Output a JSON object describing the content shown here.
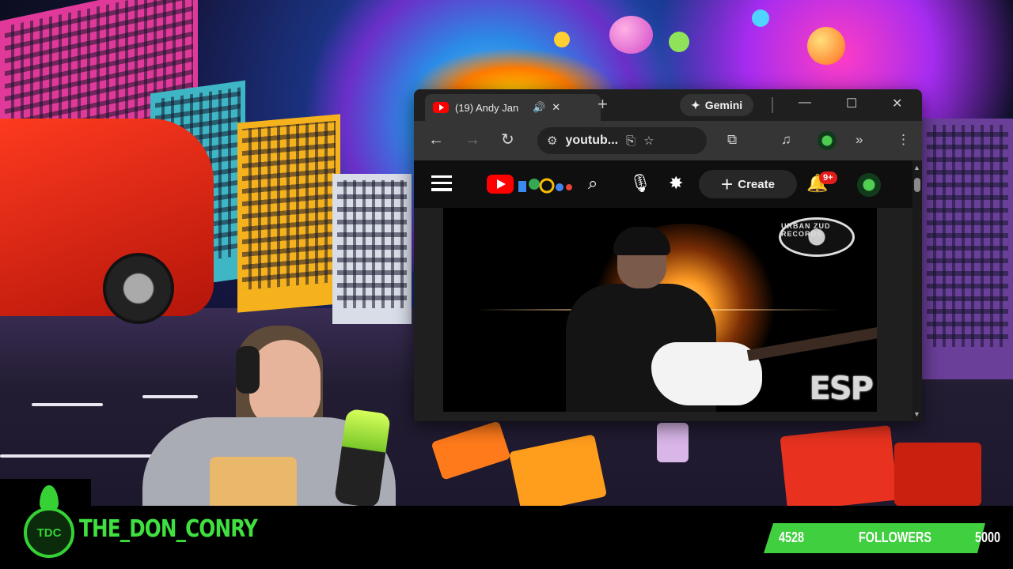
{
  "browser": {
    "tab": {
      "title": "(19) Andy Jan",
      "favicon": "youtube-icon",
      "audio_icon": "speaker-icon",
      "close": "✕"
    },
    "new_tab": "+",
    "gemini_label": "Gemini",
    "window_controls": {
      "minimize": "—",
      "maximize": "☐",
      "close": "✕"
    },
    "address_bar": {
      "url": "youtub..."
    }
  },
  "youtube": {
    "create_label": "Create",
    "notification_count": "9+"
  },
  "video": {
    "watermark_top": "URBAN ZUD RECORDS",
    "watermark_bottom": "ESP"
  },
  "overlay": {
    "streamer_name": "THE_DON_CONRY",
    "logo_text": "TDC",
    "goal": {
      "current": "4528",
      "label": "FOLLOWERS",
      "target": "5000",
      "progress_fraction": 0.9056
    },
    "accent_color": "#3fe03f"
  }
}
